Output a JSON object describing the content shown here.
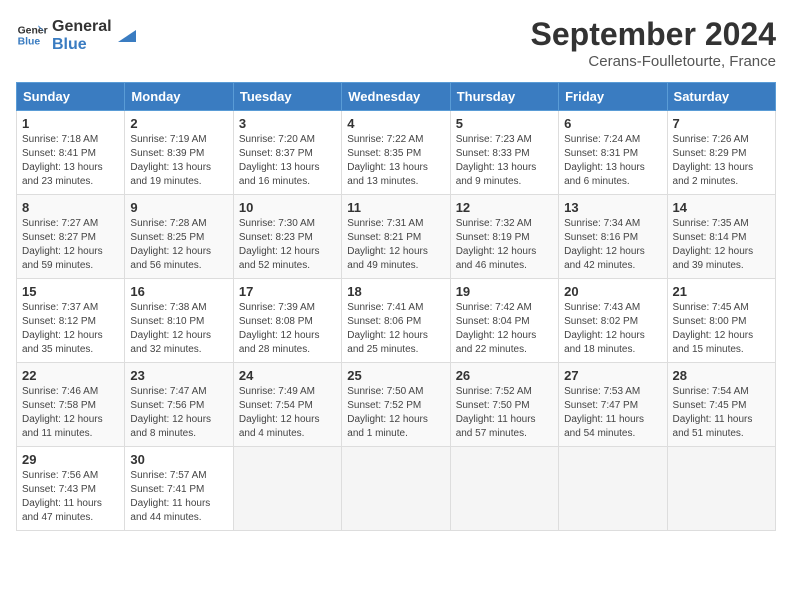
{
  "logo": {
    "text1": "General",
    "text2": "Blue"
  },
  "title": "September 2024",
  "location": "Cerans-Foulletourte, France",
  "weekdays": [
    "Sunday",
    "Monday",
    "Tuesday",
    "Wednesday",
    "Thursday",
    "Friday",
    "Saturday"
  ],
  "weeks": [
    [
      {
        "day": "1",
        "info": "Sunrise: 7:18 AM\nSunset: 8:41 PM\nDaylight: 13 hours\nand 23 minutes."
      },
      {
        "day": "2",
        "info": "Sunrise: 7:19 AM\nSunset: 8:39 PM\nDaylight: 13 hours\nand 19 minutes."
      },
      {
        "day": "3",
        "info": "Sunrise: 7:20 AM\nSunset: 8:37 PM\nDaylight: 13 hours\nand 16 minutes."
      },
      {
        "day": "4",
        "info": "Sunrise: 7:22 AM\nSunset: 8:35 PM\nDaylight: 13 hours\nand 13 minutes."
      },
      {
        "day": "5",
        "info": "Sunrise: 7:23 AM\nSunset: 8:33 PM\nDaylight: 13 hours\nand 9 minutes."
      },
      {
        "day": "6",
        "info": "Sunrise: 7:24 AM\nSunset: 8:31 PM\nDaylight: 13 hours\nand 6 minutes."
      },
      {
        "day": "7",
        "info": "Sunrise: 7:26 AM\nSunset: 8:29 PM\nDaylight: 13 hours\nand 2 minutes."
      }
    ],
    [
      {
        "day": "8",
        "info": "Sunrise: 7:27 AM\nSunset: 8:27 PM\nDaylight: 12 hours\nand 59 minutes."
      },
      {
        "day": "9",
        "info": "Sunrise: 7:28 AM\nSunset: 8:25 PM\nDaylight: 12 hours\nand 56 minutes."
      },
      {
        "day": "10",
        "info": "Sunrise: 7:30 AM\nSunset: 8:23 PM\nDaylight: 12 hours\nand 52 minutes."
      },
      {
        "day": "11",
        "info": "Sunrise: 7:31 AM\nSunset: 8:21 PM\nDaylight: 12 hours\nand 49 minutes."
      },
      {
        "day": "12",
        "info": "Sunrise: 7:32 AM\nSunset: 8:19 PM\nDaylight: 12 hours\nand 46 minutes."
      },
      {
        "day": "13",
        "info": "Sunrise: 7:34 AM\nSunset: 8:16 PM\nDaylight: 12 hours\nand 42 minutes."
      },
      {
        "day": "14",
        "info": "Sunrise: 7:35 AM\nSunset: 8:14 PM\nDaylight: 12 hours\nand 39 minutes."
      }
    ],
    [
      {
        "day": "15",
        "info": "Sunrise: 7:37 AM\nSunset: 8:12 PM\nDaylight: 12 hours\nand 35 minutes."
      },
      {
        "day": "16",
        "info": "Sunrise: 7:38 AM\nSunset: 8:10 PM\nDaylight: 12 hours\nand 32 minutes."
      },
      {
        "day": "17",
        "info": "Sunrise: 7:39 AM\nSunset: 8:08 PM\nDaylight: 12 hours\nand 28 minutes."
      },
      {
        "day": "18",
        "info": "Sunrise: 7:41 AM\nSunset: 8:06 PM\nDaylight: 12 hours\nand 25 minutes."
      },
      {
        "day": "19",
        "info": "Sunrise: 7:42 AM\nSunset: 8:04 PM\nDaylight: 12 hours\nand 22 minutes."
      },
      {
        "day": "20",
        "info": "Sunrise: 7:43 AM\nSunset: 8:02 PM\nDaylight: 12 hours\nand 18 minutes."
      },
      {
        "day": "21",
        "info": "Sunrise: 7:45 AM\nSunset: 8:00 PM\nDaylight: 12 hours\nand 15 minutes."
      }
    ],
    [
      {
        "day": "22",
        "info": "Sunrise: 7:46 AM\nSunset: 7:58 PM\nDaylight: 12 hours\nand 11 minutes."
      },
      {
        "day": "23",
        "info": "Sunrise: 7:47 AM\nSunset: 7:56 PM\nDaylight: 12 hours\nand 8 minutes."
      },
      {
        "day": "24",
        "info": "Sunrise: 7:49 AM\nSunset: 7:54 PM\nDaylight: 12 hours\nand 4 minutes."
      },
      {
        "day": "25",
        "info": "Sunrise: 7:50 AM\nSunset: 7:52 PM\nDaylight: 12 hours\nand 1 minute."
      },
      {
        "day": "26",
        "info": "Sunrise: 7:52 AM\nSunset: 7:50 PM\nDaylight: 11 hours\nand 57 minutes."
      },
      {
        "day": "27",
        "info": "Sunrise: 7:53 AM\nSunset: 7:47 PM\nDaylight: 11 hours\nand 54 minutes."
      },
      {
        "day": "28",
        "info": "Sunrise: 7:54 AM\nSunset: 7:45 PM\nDaylight: 11 hours\nand 51 minutes."
      }
    ],
    [
      {
        "day": "29",
        "info": "Sunrise: 7:56 AM\nSunset: 7:43 PM\nDaylight: 11 hours\nand 47 minutes."
      },
      {
        "day": "30",
        "info": "Sunrise: 7:57 AM\nSunset: 7:41 PM\nDaylight: 11 hours\nand 44 minutes."
      },
      {
        "day": "",
        "info": ""
      },
      {
        "day": "",
        "info": ""
      },
      {
        "day": "",
        "info": ""
      },
      {
        "day": "",
        "info": ""
      },
      {
        "day": "",
        "info": ""
      }
    ]
  ]
}
